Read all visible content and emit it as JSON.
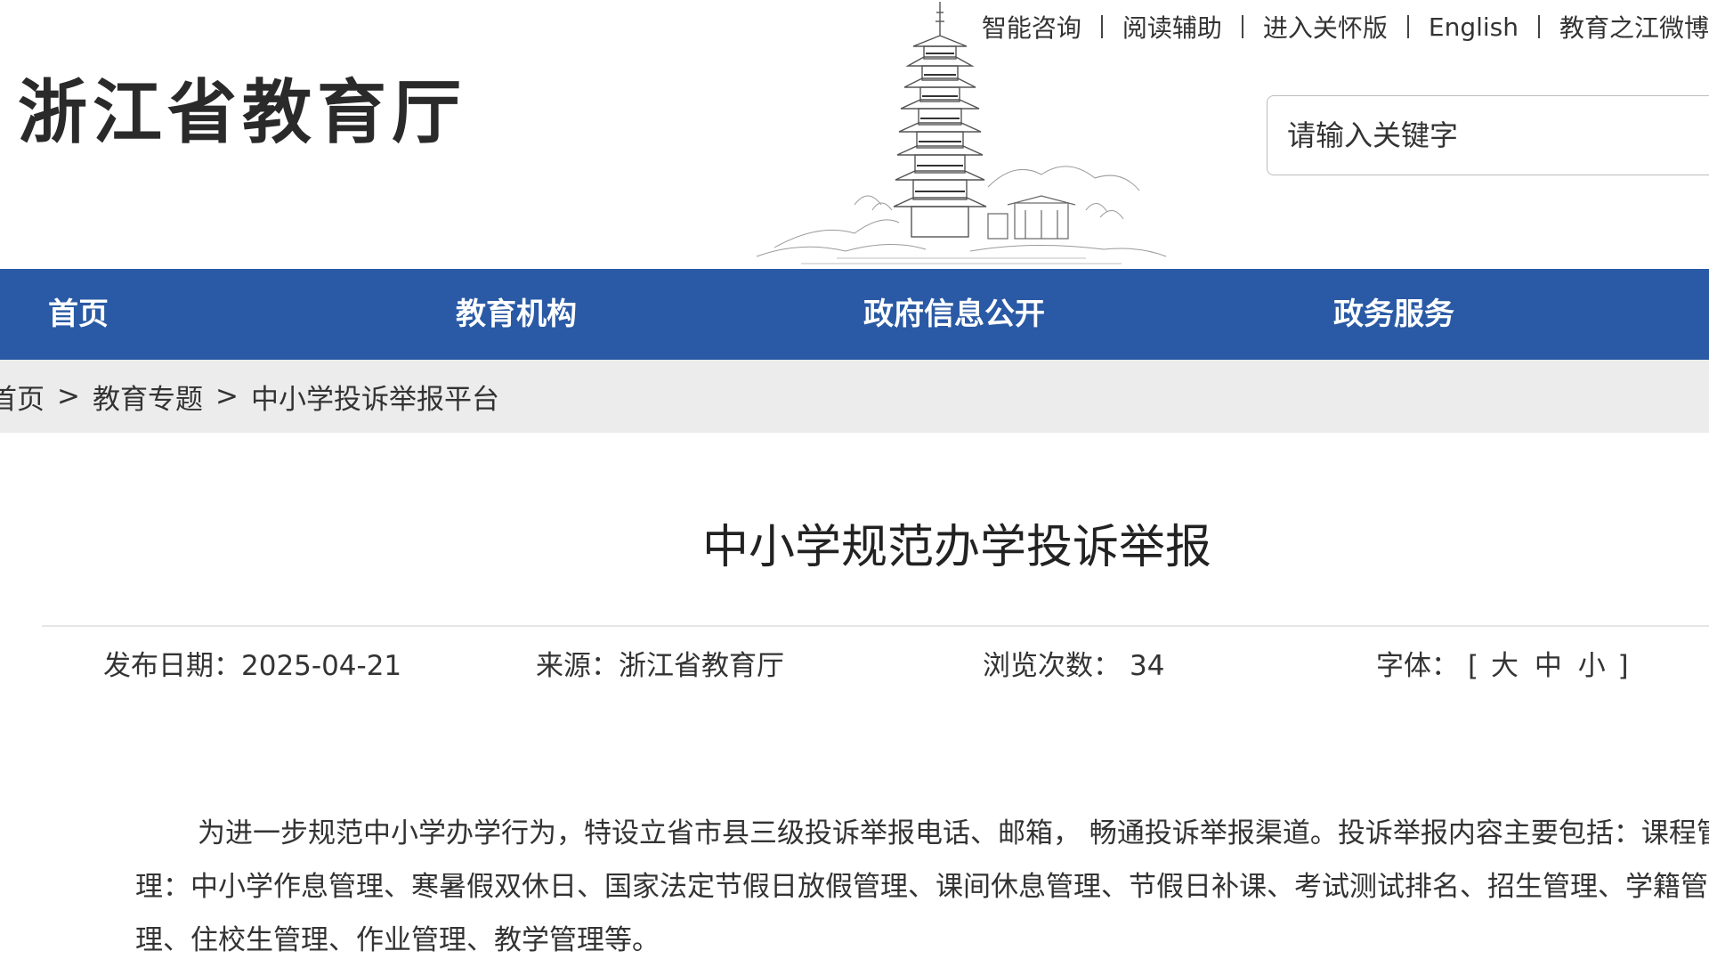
{
  "header": {
    "site_title": "浙江省教育厅",
    "top_links": [
      "智能咨询",
      "阅读辅助",
      "进入关怀版",
      "English",
      "教育之江微博"
    ],
    "search": {
      "placeholder": "请输入关键字",
      "value": ""
    }
  },
  "nav": {
    "items": [
      {
        "label": "首页"
      },
      {
        "label": "教育机构"
      },
      {
        "label": "政府信息公开"
      },
      {
        "label": "政务服务"
      }
    ]
  },
  "breadcrumb": {
    "items": [
      "首页",
      "教育专题",
      "中小学投诉举报平台"
    ],
    "separator": ">"
  },
  "article": {
    "title": "中小学规范办学投诉举报",
    "meta": {
      "date_label": "发布日期：",
      "date_value": "2025-04-21",
      "source_label": "来源：",
      "source_value": "浙江省教育厅",
      "views_label": "浏览次数：",
      "views_value": "34",
      "font_label": "字体：",
      "bracket_open": "[",
      "bracket_close": "]",
      "font_large": "大",
      "font_medium": "中",
      "font_small": "小"
    },
    "body": "为进一步规范中小学办学行为，特设立省市县三级投诉举报电话、邮箱， 畅通投诉举报渠道。投诉举报内容主要包括：课程管理：中小学作息管理、寒暑假双休日、国家法定节假日放假管理、课间休息管理、节假日补课、考试测试排名、招生管理、学籍管理、住校生管理、作业管理、教学管理等。"
  },
  "colors": {
    "nav_background": "#2a5aa5",
    "breadcrumb_background": "#ececec"
  },
  "icons": {
    "banner_illustration": "pagoda-sketch-icon"
  }
}
